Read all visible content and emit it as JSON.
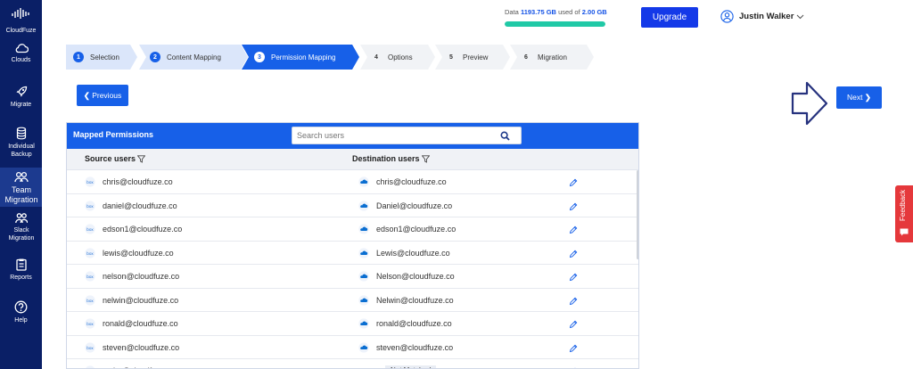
{
  "sidebar": {
    "logo": "CloudFuze",
    "items": [
      {
        "label": "Clouds",
        "icon": "cloud-icon"
      },
      {
        "label": "Migrate",
        "icon": "rocket-icon"
      },
      {
        "label": "Individual Backup",
        "icon": "database-icon"
      },
      {
        "label": "Team Migration",
        "icon": "team-icon",
        "active": true
      },
      {
        "label": "Slack Migration",
        "icon": "users-icon"
      },
      {
        "label": "Reports",
        "icon": "report-icon"
      },
      {
        "label": "Help",
        "icon": "help-icon"
      }
    ]
  },
  "header": {
    "quota_prefix": "Data",
    "quota_used": "1193.75 GB",
    "quota_mid": "used of",
    "quota_total": "2.00 GB",
    "quota_fill_percent": 100,
    "upgrade_label": "Upgrade",
    "user_name": "Justin Walker"
  },
  "stepper": {
    "steps": [
      {
        "num": "1",
        "label": "Selection",
        "state": "done"
      },
      {
        "num": "2",
        "label": "Content Mapping",
        "state": "done"
      },
      {
        "num": "3",
        "label": "Permission Mapping",
        "state": "active"
      },
      {
        "num": "4",
        "label": "Options",
        "state": "pending"
      },
      {
        "num": "5",
        "label": "Preview",
        "state": "pending"
      },
      {
        "num": "6",
        "label": "Migration",
        "state": "pending"
      }
    ]
  },
  "buttons": {
    "previous": "Previous",
    "next": "Next"
  },
  "feedback": "Feedback",
  "table": {
    "title": "Mapped Permissions",
    "search_placeholder": "Search users",
    "col_source": "Source users",
    "col_destination": "Destination users",
    "rows": [
      {
        "source": "chris@cloudfuze.co",
        "destination": "chris@cloudfuze.co"
      },
      {
        "source": "daniel@cloudfuze.co",
        "destination": "Daniel@cloudfuze.co"
      },
      {
        "source": "edson1@cloudfuze.co",
        "destination": "edson1@cloudfuze.co"
      },
      {
        "source": "lewis@cloudfuze.co",
        "destination": "Lewis@cloudfuze.co"
      },
      {
        "source": "nelson@cloudfuze.co",
        "destination": "Nelson@cloudfuze.co"
      },
      {
        "source": "nelwin@cloudfuze.co",
        "destination": "Nelwin@cloudfuze.co"
      },
      {
        "source": "ronald@cloudfuze.co",
        "destination": "ronald@cloudfuze.co"
      },
      {
        "source": "steven@cloudfuze.co",
        "destination": "steven@cloudfuze.co"
      },
      {
        "source": "taylor@cloudfuze.co",
        "destination": "",
        "status": "Not Matched"
      }
    ]
  },
  "colors": {
    "sidebar": "#0a1f66",
    "primary": "#1760e8",
    "upgrade": "#1439e8",
    "quota_fill": "#20c9a6",
    "feedback": "#e5383b"
  }
}
